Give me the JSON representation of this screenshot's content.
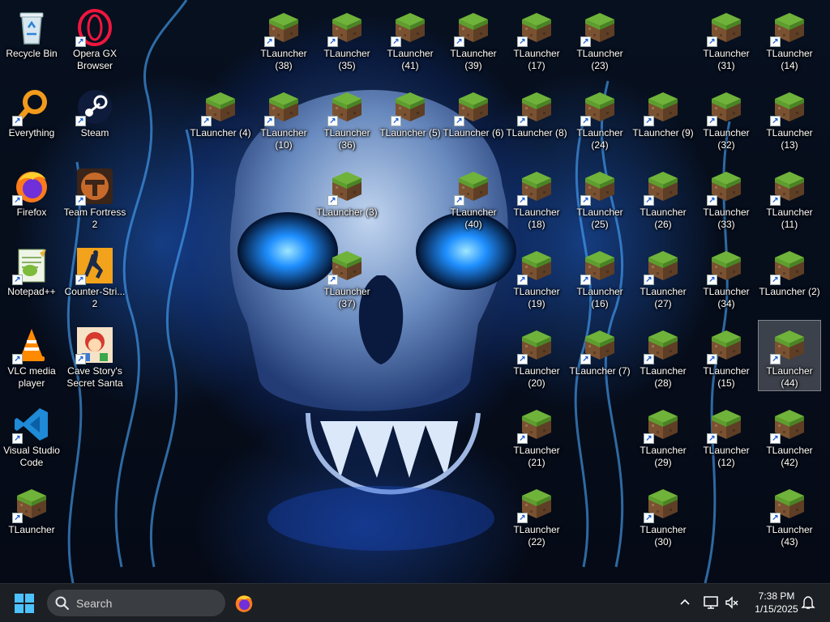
{
  "desktop": {
    "system_icons": [
      {
        "name": "recycle-bin-icon",
        "label": "Recycle Bin"
      },
      {
        "name": "opera-gx-icon",
        "label": "Opera GX Browser"
      },
      {
        "name": "everything-icon",
        "label": "Everything"
      },
      {
        "name": "steam-icon",
        "label": "Steam"
      },
      {
        "name": "firefox-icon",
        "label": "Firefox"
      },
      {
        "name": "team-fortress-icon",
        "label": "Team Fortress 2"
      },
      {
        "name": "notepadpp-icon",
        "label": "Notepad++"
      },
      {
        "name": "counter-strike-icon",
        "label": "Counter-Stri... 2"
      },
      {
        "name": "vlc-icon",
        "label": "VLC media player"
      },
      {
        "name": "cave-story-icon",
        "label": "Cave Story's Secret Santa"
      },
      {
        "name": "vscode-icon",
        "label": "Visual Studio Code"
      },
      {
        "name": "tlauncher-main-icon",
        "label": "TLauncher"
      }
    ],
    "tlauncher_labels": {
      "r1": [
        "TLauncher (38)",
        "TLauncher (35)",
        "TLauncher (41)",
        "TLauncher (39)",
        "TLauncher (17)",
        "TLauncher (23)",
        "TLauncher (31)",
        "TLauncher (14)"
      ],
      "r2": [
        "TLauncher (4)",
        "TLauncher (10)",
        "TLauncher (36)",
        "TLauncher (5)",
        "TLauncher (6)",
        "TLauncher (8)",
        "TLauncher (24)",
        "TLauncher (9)",
        "TLauncher (32)",
        "TLauncher (13)"
      ],
      "r3": [
        "TLauncher (3)",
        "TLauncher (40)",
        "TLauncher (18)",
        "TLauncher (25)",
        "TLauncher (26)",
        "TLauncher (33)",
        "TLauncher (11)"
      ],
      "r4": [
        "TLauncher (37)",
        "TLauncher (19)",
        "TLauncher (16)",
        "TLauncher (27)",
        "TLauncher (34)",
        "TLauncher (2)"
      ],
      "r5": [
        "TLauncher (20)",
        "TLauncher (7)",
        "TLauncher (28)",
        "TLauncher (15)",
        "TLauncher (44)"
      ],
      "r6": [
        "TLauncher (21)",
        "TLauncher (29)",
        "TLauncher (12)",
        "TLauncher (42)"
      ],
      "r7": [
        "TLauncher (22)",
        "TLauncher (30)",
        "TLauncher (43)"
      ]
    },
    "selected_icon": "TLauncher (44)"
  },
  "taskbar": {
    "search_placeholder": "Search",
    "pinned": [
      "firefox-icon"
    ],
    "clock_time": "7:38 PM",
    "clock_date": "1/15/2025"
  },
  "colors": {
    "taskbar": "#1c1f24",
    "accent": "#1a78e0",
    "grass_top": "#5e9e2e",
    "dirt": "#7a5232"
  }
}
